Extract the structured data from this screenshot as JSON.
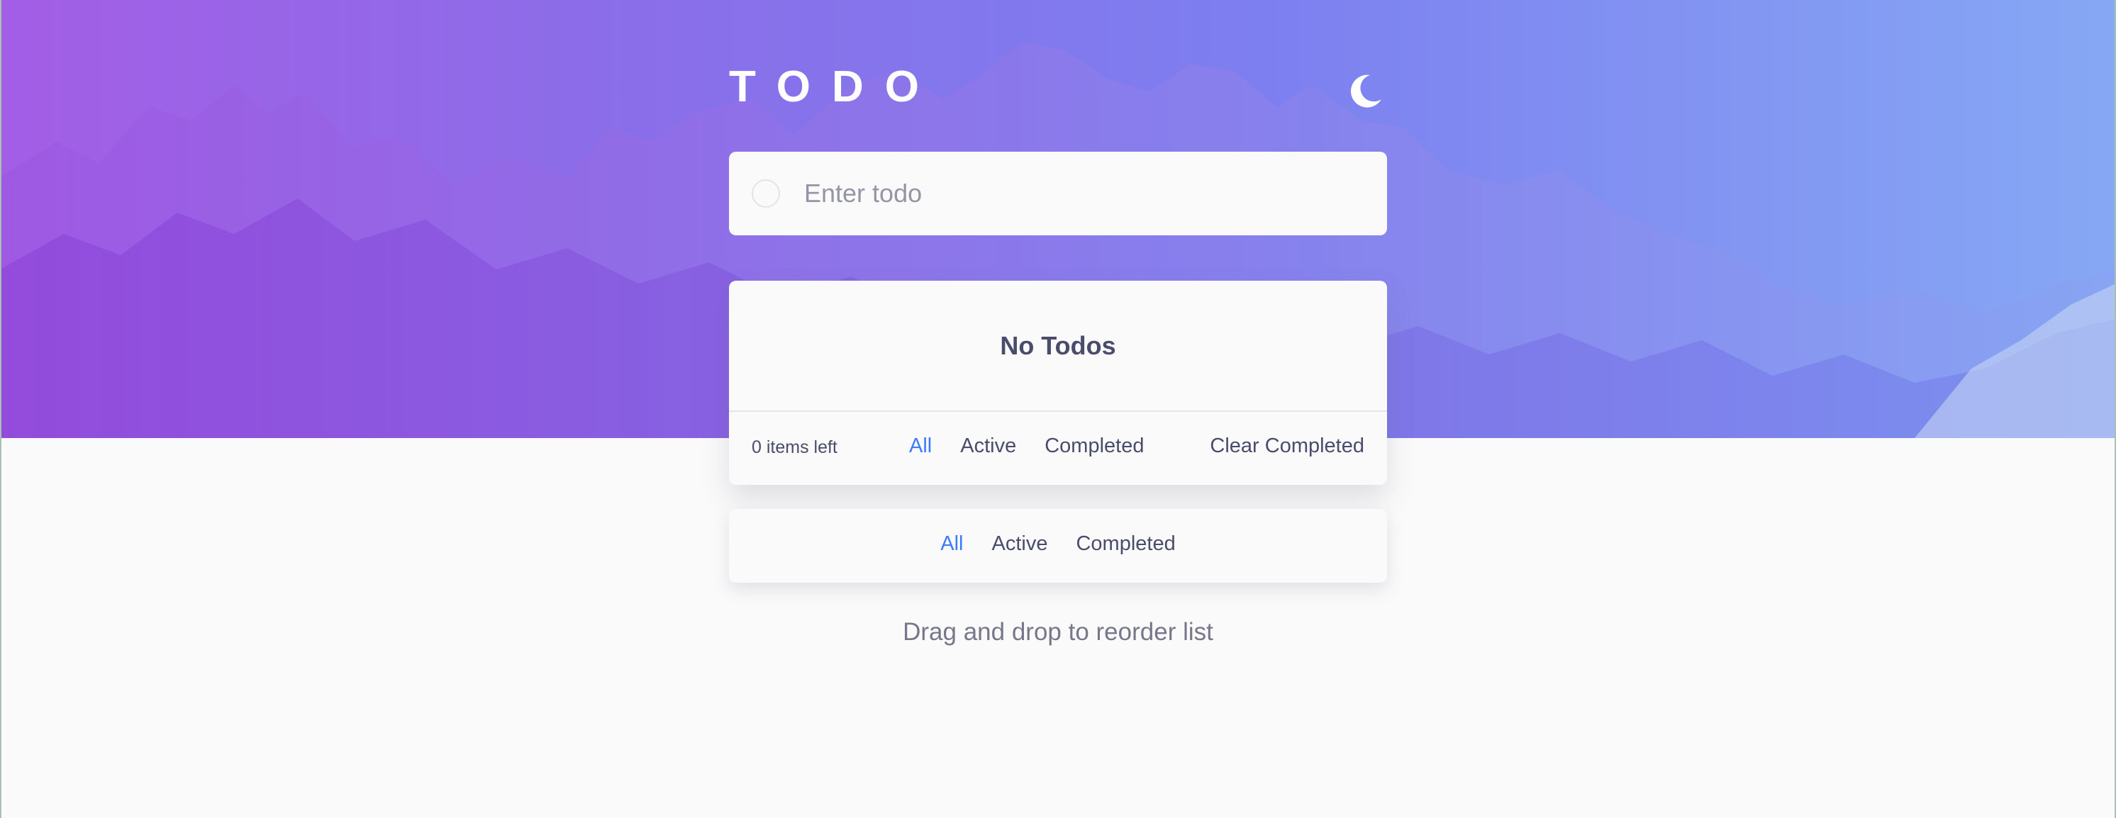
{
  "app": {
    "title": "TODO"
  },
  "header": {
    "theme_toggle_icon": "moon-icon"
  },
  "new_todo": {
    "placeholder": "Enter todo",
    "value": ""
  },
  "list": {
    "empty_message": "No Todos",
    "items": []
  },
  "footer": {
    "items_left": "0 items left",
    "filters": [
      "All",
      "Active",
      "Completed"
    ],
    "active_filter": "All",
    "clear_label": "Clear Completed"
  },
  "mobile_filters": {
    "filters": [
      "All",
      "Active",
      "Completed"
    ],
    "active_filter": "All"
  },
  "hint": "Drag and drop to reorder list",
  "colors": {
    "accent": "#3a7cfd",
    "text": "#494c6b",
    "gradient_start": "#a35ee6",
    "gradient_end": "#86a8f4",
    "background": "#fafafa"
  }
}
